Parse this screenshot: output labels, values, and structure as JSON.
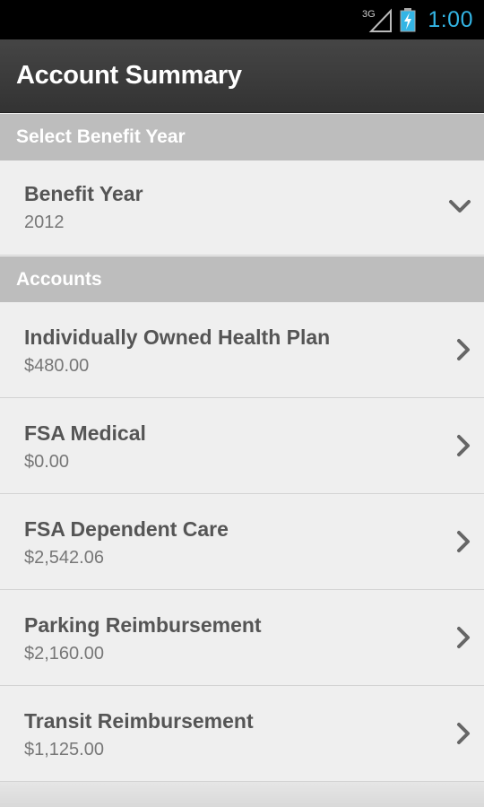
{
  "status": {
    "time": "1:00",
    "network": "3G"
  },
  "header": {
    "title": "Account Summary"
  },
  "benefit_section": {
    "header": "Select Benefit Year",
    "field_label": "Benefit Year",
    "field_value": "2012"
  },
  "accounts_section": {
    "header": "Accounts",
    "items": [
      {
        "name": "Individually Owned Health Plan",
        "amount": "$480.00"
      },
      {
        "name": "FSA Medical",
        "amount": "$0.00"
      },
      {
        "name": "FSA Dependent Care",
        "amount": "$2,542.06"
      },
      {
        "name": "Parking Reimbursement",
        "amount": "$2,160.00"
      },
      {
        "name": "Transit Reimbursement",
        "amount": "$1,125.00"
      }
    ]
  }
}
